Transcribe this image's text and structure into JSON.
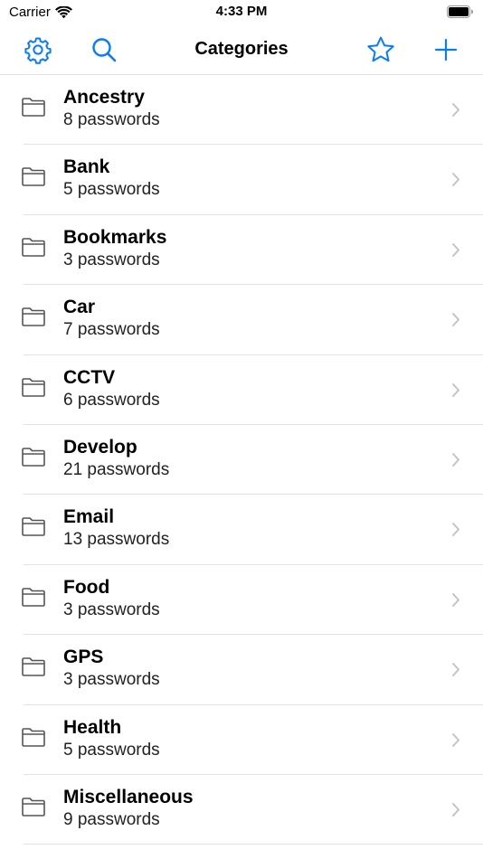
{
  "status_bar": {
    "carrier": "Carrier",
    "time": "4:33 PM"
  },
  "nav": {
    "title": "Categories",
    "left_icons": [
      "gear-icon",
      "search-icon"
    ],
    "right_icons": [
      "star-icon",
      "plus-icon"
    ]
  },
  "colors": {
    "accent": "#0a7cf5",
    "separator": "#e3e3e6",
    "chevron": "#c4c4c7",
    "folder": "#555555"
  },
  "categories": [
    {
      "name": "Ancestry",
      "count": "8 passwords"
    },
    {
      "name": "Bank",
      "count": "5 passwords"
    },
    {
      "name": "Bookmarks",
      "count": "3 passwords"
    },
    {
      "name": "Car",
      "count": "7 passwords"
    },
    {
      "name": "CCTV",
      "count": "6 passwords"
    },
    {
      "name": "Develop",
      "count": "21 passwords"
    },
    {
      "name": "Email",
      "count": "13 passwords"
    },
    {
      "name": "Food",
      "count": "3 passwords"
    },
    {
      "name": "GPS",
      "count": "3 passwords"
    },
    {
      "name": "Health",
      "count": "5 passwords"
    },
    {
      "name": "Miscellaneous",
      "count": "9 passwords"
    }
  ]
}
